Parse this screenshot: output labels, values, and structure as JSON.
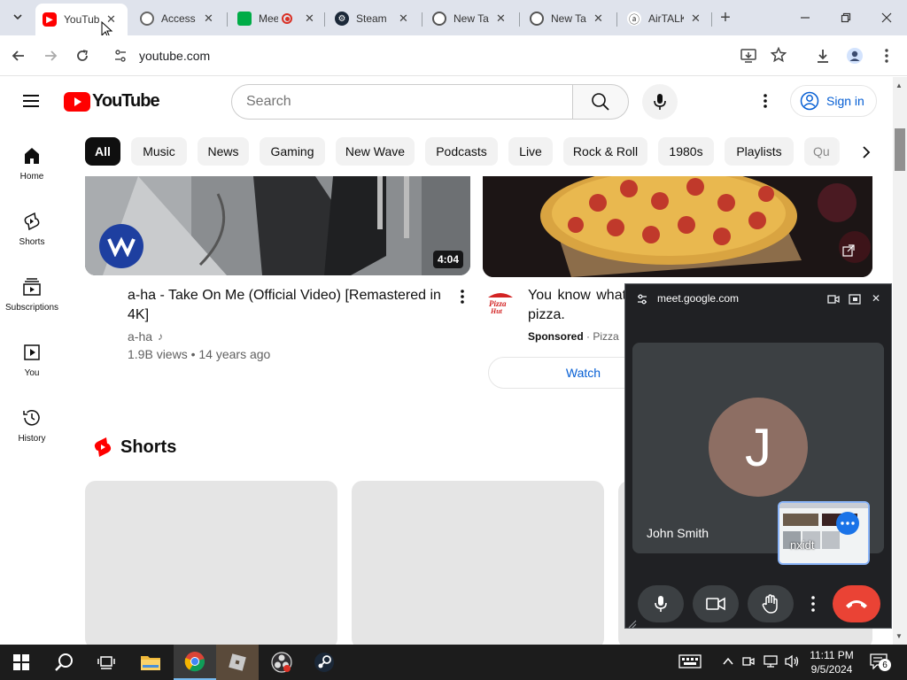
{
  "browser": {
    "tabs": [
      {
        "title": "YouTube",
        "active": true
      },
      {
        "title": "Access"
      },
      {
        "title": "Meet"
      },
      {
        "title": "Steam"
      },
      {
        "title": "New Tab"
      },
      {
        "title": "New Tab"
      },
      {
        "title": "AirTALK"
      }
    ],
    "new_tab": "+",
    "url": "youtube.com"
  },
  "youtube": {
    "logo_text": "YouTube",
    "search_placeholder": "Search",
    "sign_in": "Sign in",
    "nav": [
      {
        "label": "Home"
      },
      {
        "label": "Shorts"
      },
      {
        "label": "Subscriptions"
      },
      {
        "label": "You"
      },
      {
        "label": "History"
      }
    ],
    "chips": [
      "All",
      "Music",
      "News",
      "Gaming",
      "New Wave",
      "Podcasts",
      "Live",
      "Rock & Roll",
      "1980s",
      "Playlists",
      "Qu"
    ],
    "videos": [
      {
        "title": "a-ha - Take On Me (Official Video) [Remastered in 4K]",
        "channel": "a-ha",
        "meta": "1.9B views • 14 years ago",
        "duration": "4:04"
      },
      {
        "title": "You know what pizza.",
        "sponsored": "Sponsored",
        "advertiser": "Pizza",
        "action": "Watch"
      }
    ],
    "shorts_heading": "Shorts"
  },
  "meet": {
    "domain": "meet.google.com",
    "participant": "John Smith",
    "avatar_letter": "J",
    "self_label": "nxidt"
  },
  "taskbar": {
    "time": "11:11 PM",
    "date": "9/5/2024",
    "notif_count": "6"
  },
  "colors": {
    "youtube_red": "#ff0000",
    "meet_end": "#ea4335",
    "chip_selected": "#0f0f0f",
    "link_blue": "#065fd4"
  }
}
